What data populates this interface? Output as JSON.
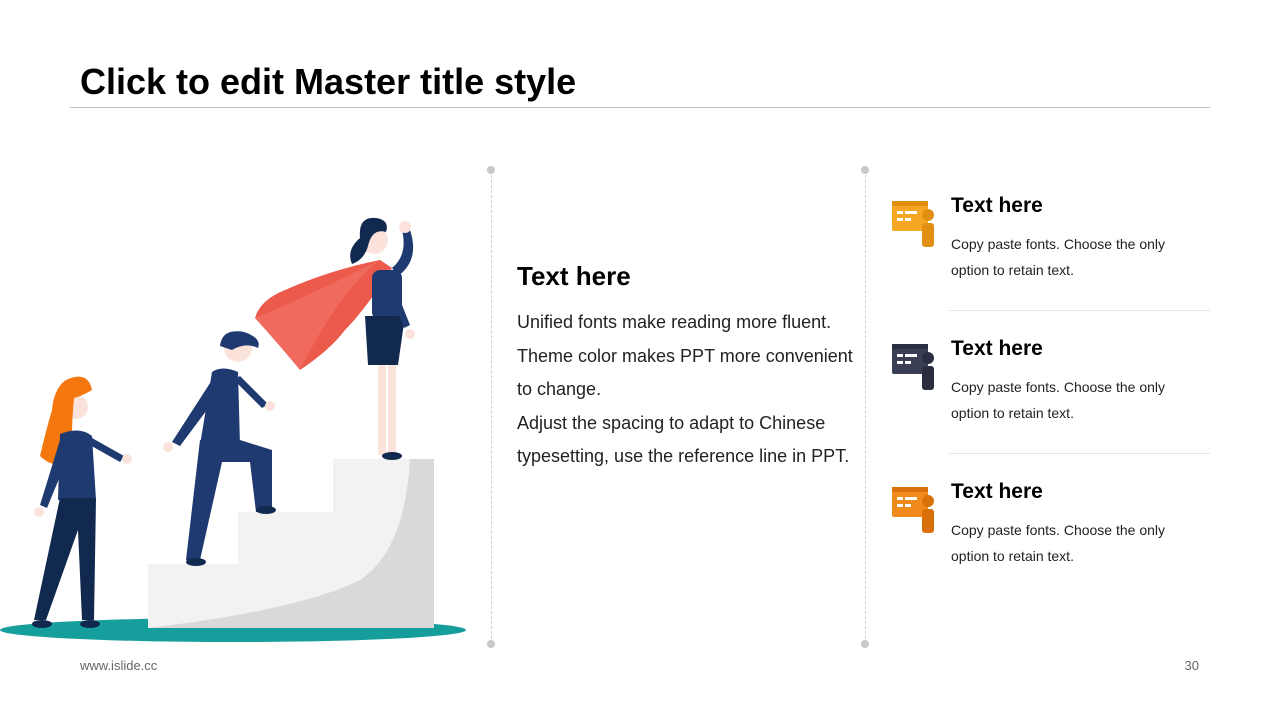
{
  "slide": {
    "title": "Click to edit Master title style",
    "footer_url": "www.islide.cc",
    "page_number": "30"
  },
  "center": {
    "heading": "Text here",
    "paragraphs": [
      "Unified fonts make reading more fluent. Theme color makes PPT more convenient to change.",
      "Adjust the spacing to adapt to Chinese typesetting, use the reference line in PPT."
    ]
  },
  "items": [
    {
      "heading": "Text here",
      "text": "Copy paste fonts. Choose the only option to retain text.",
      "icon": "presenter-board-icon",
      "color": "#F5A623"
    },
    {
      "heading": "Text here",
      "text": "Copy paste fonts. Choose the only option to retain text.",
      "icon": "presenter-board-icon",
      "color": "#3A3F55"
    },
    {
      "heading": "Text here",
      "text": "Copy paste fonts. Choose the only option to retain text.",
      "icon": "presenter-board-icon",
      "color": "#F08A1C"
    }
  ],
  "colors": {
    "orange": "#F5A623",
    "dark": "#3A3F55",
    "deep_orange": "#F08A1C",
    "teal": "#169E9C",
    "navy": "#1F3A70",
    "cape_red": "#EC5A4B"
  }
}
